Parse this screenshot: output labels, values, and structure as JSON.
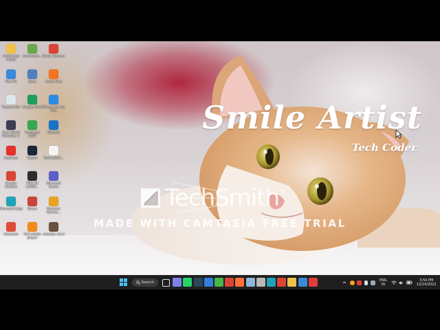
{
  "wallpaper": {
    "title": "Smile Artist",
    "subtitle": "Tech Coder"
  },
  "watermark": {
    "brand": "TechSmith",
    "registered": "®",
    "trial_text": "MADE WITH CAMTASIA FREE TRIAL"
  },
  "desktop_icons": [
    {
      "name": "folder-icon",
      "label": "Archimnat install",
      "color": "#f1c24b"
    },
    {
      "name": "app-icon",
      "label": "Archimnat...",
      "color": "#6aa84f"
    },
    {
      "name": "chrome-icon",
      "label": "Smile Chrome",
      "color": "#db4437"
    },
    {
      "name": "pc-icon",
      "label": "This PC",
      "color": "#3b8ad9"
    },
    {
      "name": "tyers-icon",
      "label": "Tyers",
      "color": "#4f7fbf"
    },
    {
      "name": "avast-icon",
      "label": "Avast Free",
      "color": "#f47321"
    },
    {
      "name": "recycle-bin-icon",
      "label": "Recycle Bin",
      "color": "#dfe7ee"
    },
    {
      "name": "google-chat-icon",
      "label": "Google Chat",
      "color": "#1e9e5a"
    },
    {
      "name": "onedrive-icon",
      "label": "Where are my files",
      "color": "#2b8be6"
    },
    {
      "name": "game-icon",
      "label": "New World Demister 2",
      "color": "#3d3d55"
    },
    {
      "name": "camtasia-icon",
      "label": "Camtasia 2022",
      "color": "#34a853"
    },
    {
      "name": "outlook-icon",
      "label": "Outlook",
      "color": "#1a73c9"
    },
    {
      "name": "anydesk-icon",
      "label": "AnyDesk",
      "color": "#e4322b"
    },
    {
      "name": "steam-icon",
      "label": "Steam",
      "color": "#1b2838"
    },
    {
      "name": "document-icon",
      "label": "TechnySoft...",
      "color": "#f4f4f4"
    },
    {
      "name": "chrome-icon",
      "label": "Google Chrome",
      "color": "#db4437"
    },
    {
      "name": "game-icon",
      "label": "FIFA 23 LATER...",
      "color": "#2d2d2d"
    },
    {
      "name": "teams-icon",
      "label": "Microsoft Teams",
      "color": "#5b5fc7"
    },
    {
      "name": "edge-icon",
      "label": "Microsoft Edge",
      "color": "#1fa3b8"
    },
    {
      "name": "app-icon",
      "label": "Brave",
      "color": "#c8453c"
    },
    {
      "name": "rockstar-icon",
      "label": "Rockstar Games...",
      "color": "#e8a321"
    },
    {
      "name": "app-icon",
      "label": "Universe",
      "color": "#e04b3a"
    },
    {
      "name": "vlc-icon",
      "label": "VLC media player",
      "color": "#f08a1a"
    },
    {
      "name": "avatar-icon",
      "label": "rockstar vid d",
      "color": "#6a5140"
    }
  ],
  "taskbar": {
    "search_label": "Search",
    "apps": [
      {
        "name": "task-view-icon",
        "color": "#e8e8e8"
      },
      {
        "name": "teams-chat-icon",
        "color": "#7b83eb"
      },
      {
        "name": "whatsapp-icon",
        "color": "#25d366"
      },
      {
        "name": "steam-icon",
        "color": "#2a475e"
      },
      {
        "name": "vscode-icon",
        "color": "#2f80d8"
      },
      {
        "name": "camtasia-icon",
        "color": "#45b649"
      },
      {
        "name": "chrome-icon",
        "color": "#db4437"
      },
      {
        "name": "firefox-icon",
        "color": "#ff7139"
      },
      {
        "name": "notepad-icon",
        "color": "#8fb7d9"
      },
      {
        "name": "database-icon",
        "color": "#b9b9b9"
      },
      {
        "name": "edge-icon",
        "color": "#1fa3b8"
      },
      {
        "name": "chrome-icon",
        "color": "#db4437"
      },
      {
        "name": "file-explorer-icon",
        "color": "#f1c24b"
      },
      {
        "name": "store-icon",
        "color": "#3b8ad9"
      },
      {
        "name": "camtasia-recorder-icon",
        "color": "#e13c3c"
      }
    ],
    "language": "ENG",
    "region": "IN",
    "time": "3:50 PM",
    "date": "12/14/2022"
  }
}
